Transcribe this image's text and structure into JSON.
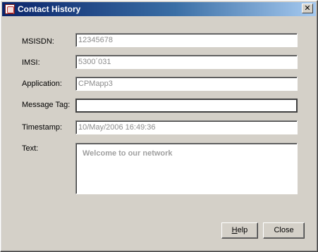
{
  "window": {
    "title": "Contact History",
    "close_symbol": "✕"
  },
  "form": {
    "msisdn": {
      "label": "MSISDN:",
      "value": "12345678"
    },
    "imsi": {
      "label": "IMSI:",
      "value": "5300´031"
    },
    "application": {
      "label": "Application:",
      "value": "CPMapp3"
    },
    "message_tag": {
      "label": "Message Tag:",
      "value": ""
    },
    "timestamp": {
      "label": "Timestamp:",
      "value": "10/May/2006 16:49:36"
    },
    "text": {
      "label": "Text:",
      "value": "Welcome to our network"
    }
  },
  "buttons": {
    "help_mnemonic": "H",
    "help_rest": "elp",
    "close": "Close"
  }
}
